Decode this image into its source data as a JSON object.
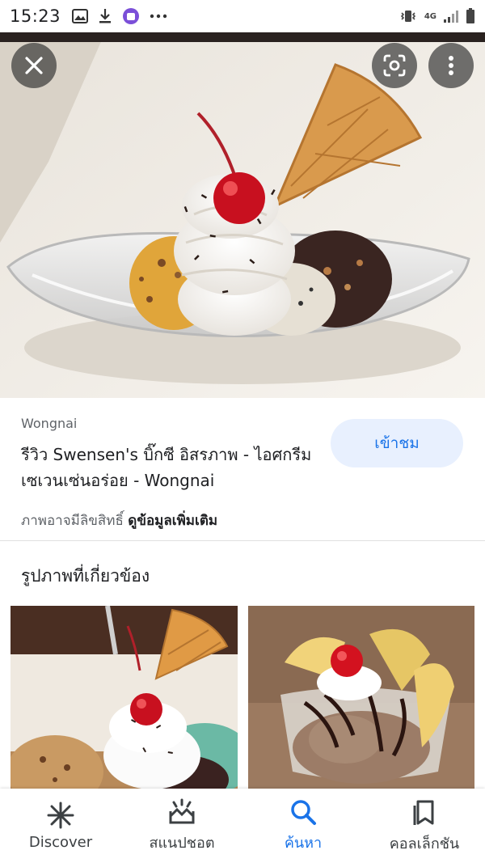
{
  "status_bar": {
    "time": "15:23",
    "network_label": "4G",
    "icons": [
      "image-icon",
      "download-icon",
      "app-badge-icon",
      "more-dots-icon",
      "vibrate-icon",
      "signal-icon",
      "battery-icon"
    ]
  },
  "hero": {
    "buttons": [
      "close-icon",
      "google-lens-icon",
      "more-vert-icon"
    ]
  },
  "result": {
    "source": "Wongnai",
    "title": "รีวิว Swensen's บิ๊กซี อิสรภาพ - ไอศกรีมเซเวนเซ่นอร่อย - Wongnai",
    "visit_label": "เข้าชม",
    "copyright_note": "ภาพอาจมีลิขสิทธิ์",
    "more_info_label": "ดูข้อมูลเพิ่มเติม"
  },
  "related": {
    "title": "รูปภาพที่เกี่ยวข้อง"
  },
  "bottom_nav": {
    "items": [
      {
        "label": "Discover",
        "icon": "discover-asterisk-icon"
      },
      {
        "label": "สแนปชอต",
        "icon": "snapshot-icon"
      },
      {
        "label": "ค้นหา",
        "icon": "search-icon"
      },
      {
        "label": "คอลเล็กชัน",
        "icon": "collections-icon"
      }
    ],
    "active_index": 2
  },
  "colors": {
    "accent": "#1a73e8",
    "visit_button_bg": "#e8f0fe",
    "secondary_text": "#5f6368"
  }
}
